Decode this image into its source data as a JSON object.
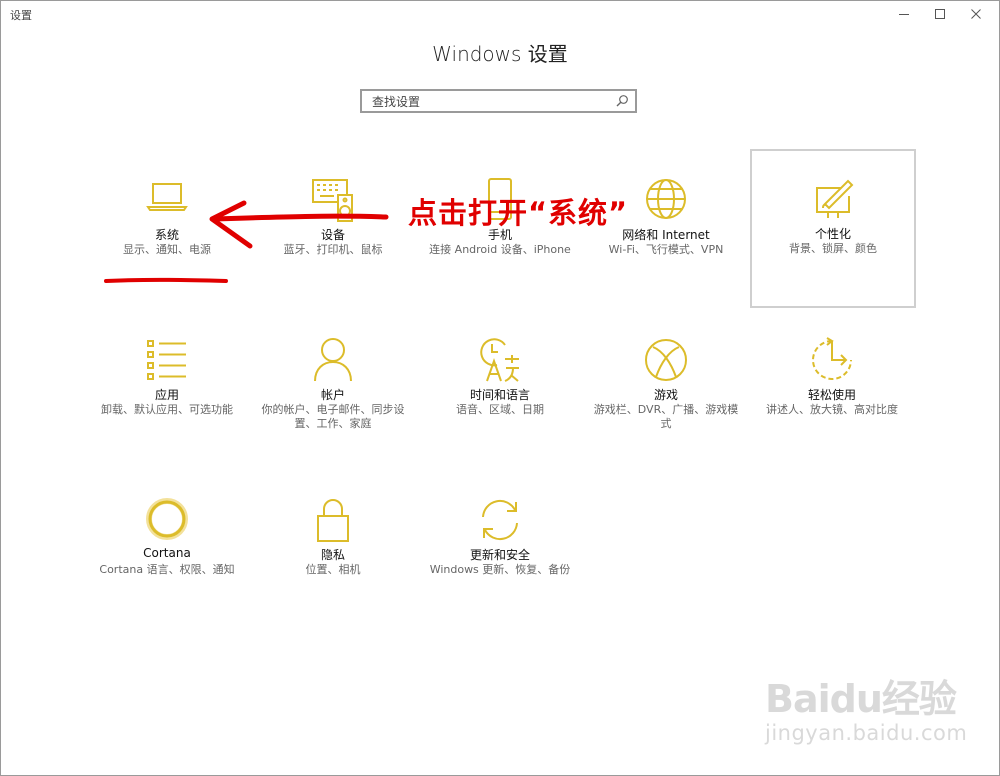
{
  "window": {
    "app_title": "设置",
    "minimize_glyph": "—",
    "maximize_glyph": "☐",
    "close_glyph": "✕"
  },
  "page_title": "Windows 设置",
  "search": {
    "placeholder": "查找设置",
    "icon": "search-icon"
  },
  "accent_color": "#dcbc2a",
  "annotation": {
    "callout_text": "点击打开“系统”",
    "color": "#e00000"
  },
  "tiles": [
    {
      "title": "系统",
      "desc": "显示、通知、电源",
      "icon": "laptop-icon"
    },
    {
      "title": "设备",
      "desc": "蓝牙、打印机、鼠标",
      "icon": "keyboard-speaker-icon"
    },
    {
      "title": "手机",
      "desc": "连接 Android 设备、iPhone",
      "icon": "phone-icon"
    },
    {
      "title": "网络和 Internet",
      "desc": "Wi-Fi、飞行模式、VPN",
      "icon": "globe-icon"
    },
    {
      "title": "个性化",
      "desc": "背景、锁屏、颜色",
      "icon": "paint-monitor-icon"
    },
    {
      "title": "应用",
      "desc": "卸载、默认应用、可选功能",
      "icon": "app-list-icon"
    },
    {
      "title": "帐户",
      "desc": "你的帐户、电子邮件、同步设置、工作、家庭",
      "icon": "person-icon"
    },
    {
      "title": "时间和语言",
      "desc": "语音、区域、日期",
      "icon": "time-language-icon"
    },
    {
      "title": "游戏",
      "desc": "游戏栏、DVR、广播、游戏模式",
      "icon": "xbox-icon"
    },
    {
      "title": "轻松使用",
      "desc": "讲述人、放大镜、高对比度",
      "icon": "ease-of-access-icon"
    },
    {
      "title": "Cortana",
      "desc": "Cortana 语言、权限、通知",
      "icon": "cortana-icon"
    },
    {
      "title": "隐私",
      "desc": "位置、相机",
      "icon": "lock-icon"
    },
    {
      "title": "更新和安全",
      "desc": "Windows 更新、恢复、备份",
      "icon": "sync-icon"
    }
  ],
  "watermark": {
    "logo": "Baidu经验",
    "site": "jingyan.baidu.com"
  }
}
